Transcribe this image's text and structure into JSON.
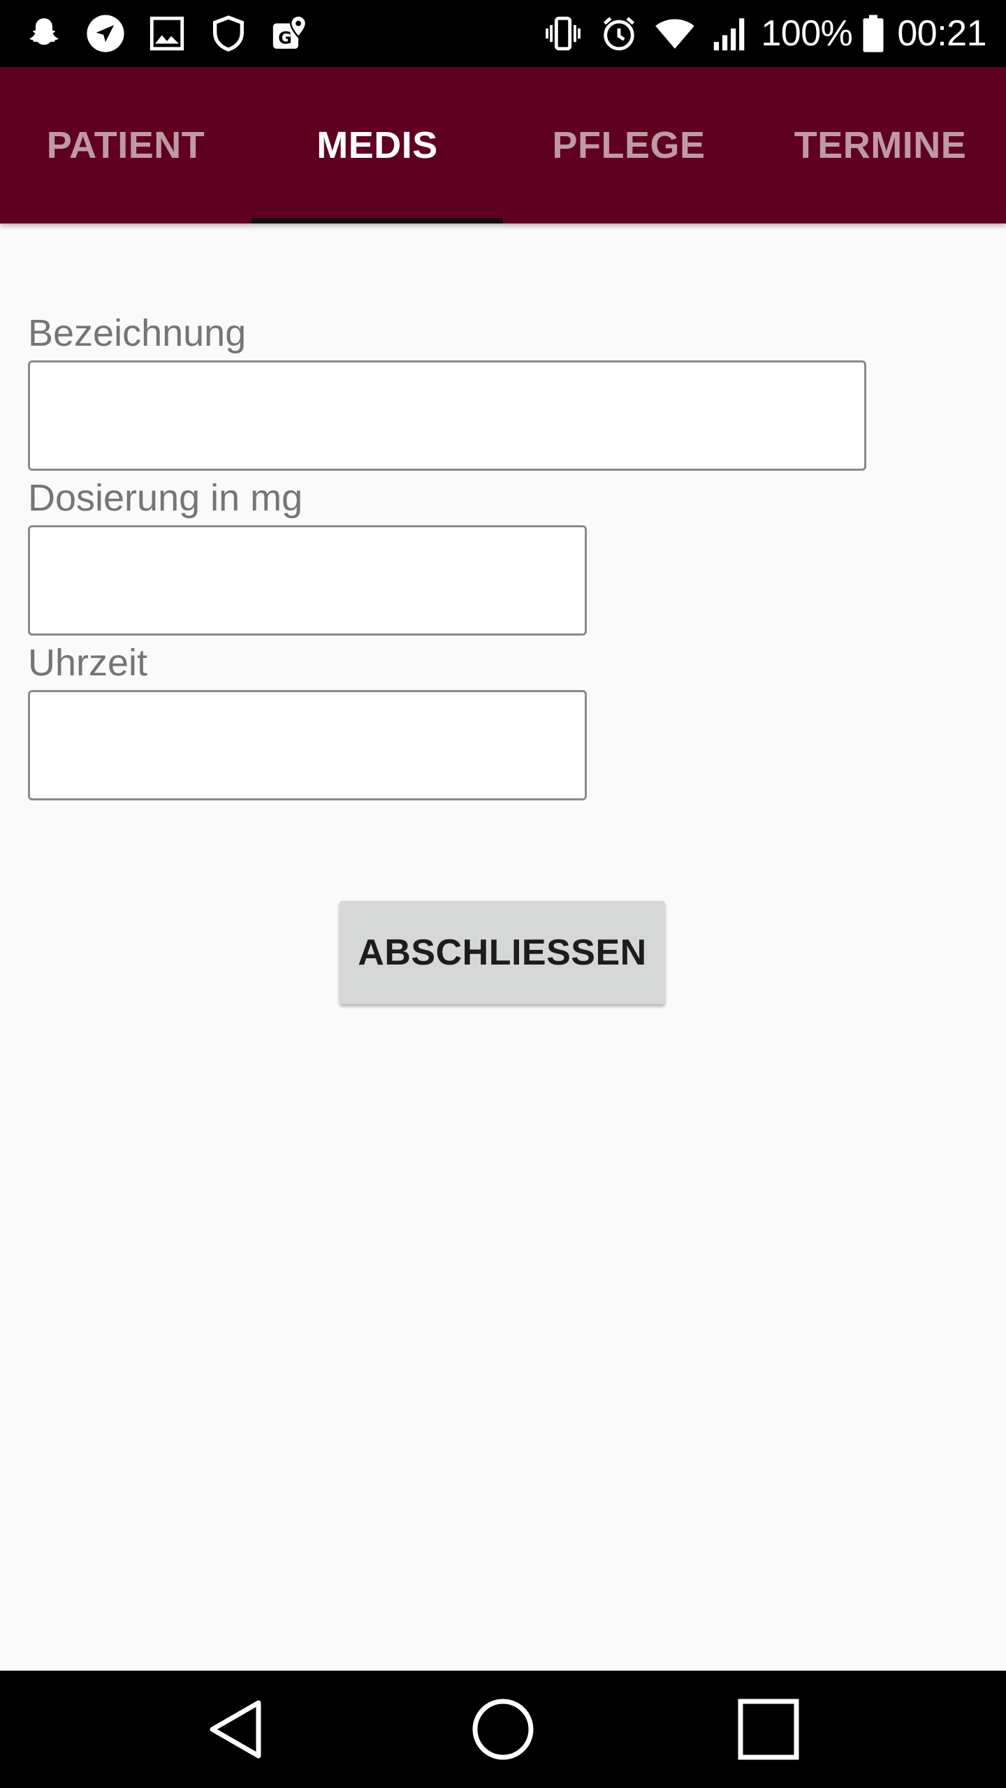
{
  "status_bar": {
    "left_icons": [
      "snapchat-icon",
      "navigation-icon",
      "image-icon",
      "shield-icon",
      "maps-icon"
    ],
    "right_icons": [
      "vibrate-icon",
      "alarm-icon",
      "wifi-icon",
      "signal-icon",
      "battery-icon"
    ],
    "battery": "100%",
    "time": "00:21"
  },
  "tabs": [
    {
      "label": "PATIENT",
      "active": false
    },
    {
      "label": "MEDIS",
      "active": true
    },
    {
      "label": "PFLEGE",
      "active": false
    },
    {
      "label": "TERMINE",
      "active": false
    }
  ],
  "form": {
    "fields": [
      {
        "label": "Bezeichnung",
        "value": ""
      },
      {
        "label": "Dosierung in mg",
        "value": ""
      },
      {
        "label": "Uhrzeit",
        "value": ""
      }
    ],
    "submit_label": "ABSCHLIESSEN"
  },
  "nav_bar": {
    "buttons": [
      "back-icon",
      "home-icon",
      "recents-icon"
    ]
  },
  "colors": {
    "tab_bar": "#5f0020",
    "background": "#fafafa",
    "button": "#d6d7d7"
  }
}
